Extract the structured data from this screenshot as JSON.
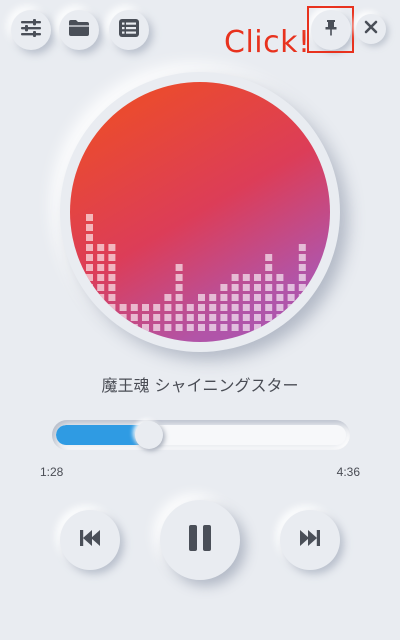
{
  "toolbar": {
    "settings_icon": "sliders-icon",
    "folder_icon": "folder-icon",
    "playlist_icon": "playlist-icon",
    "pin_icon": "pin-icon",
    "close_icon": "close-icon"
  },
  "annotation": {
    "label": "Click!",
    "color": "#e8321e"
  },
  "track": {
    "title": "魔王魂 シャイニングスター",
    "current_time": "1:28",
    "total_time": "4:36",
    "progress": 0.319
  },
  "controls": {
    "prev_icon": "skip-previous-icon",
    "pause_icon": "pause-icon",
    "next_icon": "skip-next-icon"
  },
  "colors": {
    "background": "#e9ecf1",
    "accent": "#2f9be3",
    "art_gradient": [
      "#f0501f",
      "#dc3d58",
      "#a558b9"
    ]
  },
  "visualizer": {
    "levels": [
      12,
      9,
      9,
      3,
      3,
      3,
      3,
      4,
      7,
      3,
      4,
      4,
      5,
      6,
      6,
      6,
      8,
      6,
      5,
      9
    ]
  }
}
